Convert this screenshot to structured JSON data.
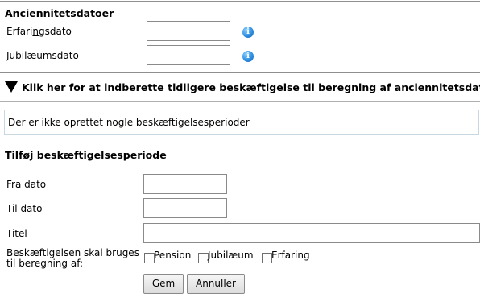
{
  "seniority": {
    "heading": "Anciennitetsdatoer",
    "experience_label_pre": "Erfari",
    "experience_label_accel": "n",
    "experience_label_post": "gsdato",
    "experience_value": "",
    "jubilee_label_accel": "J",
    "jubilee_label_post": "ubilæumsdato",
    "jubilee_value": ""
  },
  "expander": {
    "label": "Klik her for at indberette tidligere beskæftigelse til beregning af anciennitetsdatoer"
  },
  "employment_list": {
    "empty_text": "Der er ikke oprettet nogle beskæftigelsesperioder"
  },
  "add_period": {
    "heading": "Tilføj beskæftigelsesperiode",
    "from_label": "Fra dato",
    "from_value": "",
    "to_label": "Til dato",
    "to_value": "",
    "title_label": "Titel",
    "title_value": "",
    "usage_label_line1": "Beskæftigelsen skal bruges",
    "usage_label_line2": "til beregning af:",
    "options": [
      {
        "label": "Pension",
        "checked": false
      },
      {
        "label": "Jubilæum",
        "checked": false
      },
      {
        "label": "Erfaring",
        "checked": false
      }
    ],
    "save_label": "Gem",
    "cancel_label": "Annuller"
  },
  "icons": {
    "info": "info-icon",
    "expander": "triangle-down-icon"
  },
  "colors": {
    "rule": "#8f8f8f",
    "info_blue": "#2f8fe0",
    "empty_box_border": "#c9d7e0"
  }
}
